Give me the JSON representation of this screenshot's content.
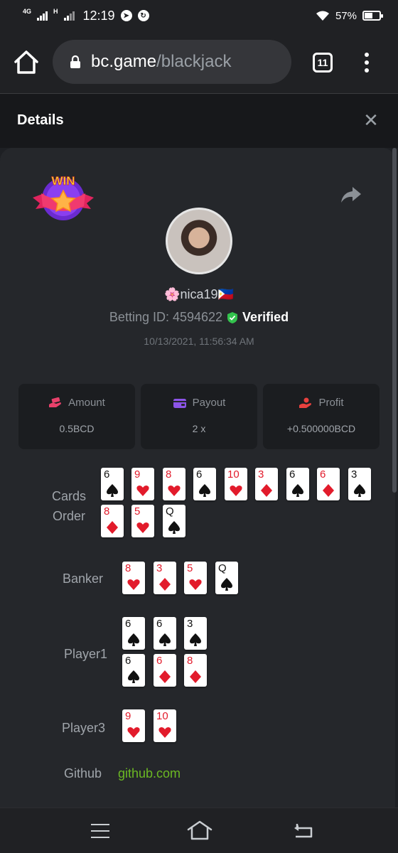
{
  "status_bar": {
    "network": "4G",
    "network2": "H",
    "time": "12:19",
    "battery": "57%",
    "battery_level": 0.57
  },
  "browser": {
    "url_host": "bc.game",
    "url_path": "/blackjack",
    "tab_count": "11"
  },
  "details": {
    "title": "Details",
    "badge_text": "WIN"
  },
  "profile": {
    "username": "🌸nica19🇵🇭",
    "betting_id_label": "Betting ID: 4594622",
    "verified_label": "Verified",
    "timestamp": "10/13/2021, 11:56:34 AM"
  },
  "stats": [
    {
      "label": "Amount",
      "value": "0.5BCD",
      "icon": "money-hand-icon",
      "color": "#e8416b"
    },
    {
      "label": "Payout",
      "value": "2 x",
      "icon": "wallet-icon",
      "color": "#8c54e8"
    },
    {
      "label": "Profit",
      "value": "+0.500000BCD",
      "icon": "profit-hand-icon",
      "color": "#e8413e"
    }
  ],
  "labels": {
    "cards_order": "Cards\nOrder",
    "cards_line1": "Cards",
    "cards_line2": "Order",
    "banker": "Banker",
    "player1": "Player1",
    "player3": "Player3",
    "github": "Github",
    "github_link": "github.com"
  },
  "cards_order": [
    {
      "rank": "6",
      "suit": "spade"
    },
    {
      "rank": "9",
      "suit": "heart"
    },
    {
      "rank": "8",
      "suit": "heart"
    },
    {
      "rank": "6",
      "suit": "spade"
    },
    {
      "rank": "10",
      "suit": "heart"
    },
    {
      "rank": "3",
      "suit": "diamond"
    },
    {
      "rank": "6",
      "suit": "spade"
    },
    {
      "rank": "6",
      "suit": "diamond"
    },
    {
      "rank": "3",
      "suit": "spade"
    },
    {
      "rank": "8",
      "suit": "diamond"
    },
    {
      "rank": "5",
      "suit": "heart"
    },
    {
      "rank": "Q",
      "suit": "spade"
    }
  ],
  "banker": [
    {
      "rank": "8",
      "suit": "heart"
    },
    {
      "rank": "3",
      "suit": "diamond"
    },
    {
      "rank": "5",
      "suit": "heart"
    },
    {
      "rank": "Q",
      "suit": "spade"
    }
  ],
  "player1": [
    {
      "rank": "6",
      "suit": "spade"
    },
    {
      "rank": "6",
      "suit": "spade"
    },
    {
      "rank": "3",
      "suit": "spade"
    },
    {
      "rank": "6",
      "suit": "spade"
    },
    {
      "rank": "6",
      "suit": "diamond"
    },
    {
      "rank": "8",
      "suit": "diamond"
    }
  ],
  "player3": [
    {
      "rank": "9",
      "suit": "heart"
    },
    {
      "rank": "10",
      "suit": "heart"
    }
  ]
}
